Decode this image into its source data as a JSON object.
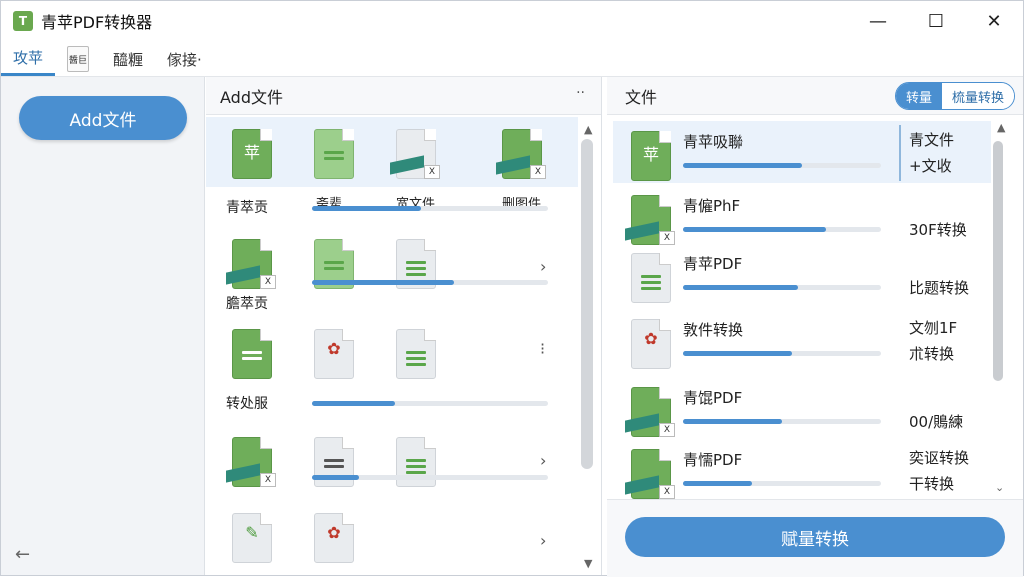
{
  "window": {
    "title": "青苹PDF转换器",
    "minimize": "—",
    "maximize": "☐",
    "close": "✕"
  },
  "tabs": [
    {
      "label": "攻苹"
    },
    {
      "label": "醬巨"
    },
    {
      "label": "醯糎"
    },
    {
      "label": "傢接·"
    }
  ],
  "sidebar": {
    "add_label": "Add文件",
    "back": "←"
  },
  "files_panel": {
    "title": "Add文件",
    "menu": "··",
    "labels": [
      "青萃贡",
      "斋辈",
      "宽文件",
      "删图件",
      "膽萃贡",
      "转处服"
    ],
    "chevrons": [
      "›",
      "›",
      "⁝",
      "›",
      "›"
    ],
    "progress": [
      0.46,
      0.6,
      0.35,
      0.2
    ]
  },
  "jobs_panel": {
    "title": "文件",
    "toggle": {
      "single": "转量",
      "batch": "梳量转换"
    },
    "jobs": [
      {
        "name": "青苹吸聯",
        "status": "青文件\n+文收",
        "progress": 0.6
      },
      {
        "name": "青僱PhF",
        "status": "\n30F转换",
        "progress": 0.72
      },
      {
        "name": "青苹PDF",
        "status": "\n比题转换",
        "progress": 0.58
      },
      {
        "name": "敦件转换",
        "status": "文刎1F\n朮转换",
        "progress": 0.55
      },
      {
        "name": "青馄PDF",
        "status": "\n00/鵙練",
        "progress": 0.5
      },
      {
        "name": "青懦PDF",
        "status": "奕讴转换\n干转换",
        "progress": 0.35
      }
    ],
    "batch_button": "赋量转换"
  }
}
